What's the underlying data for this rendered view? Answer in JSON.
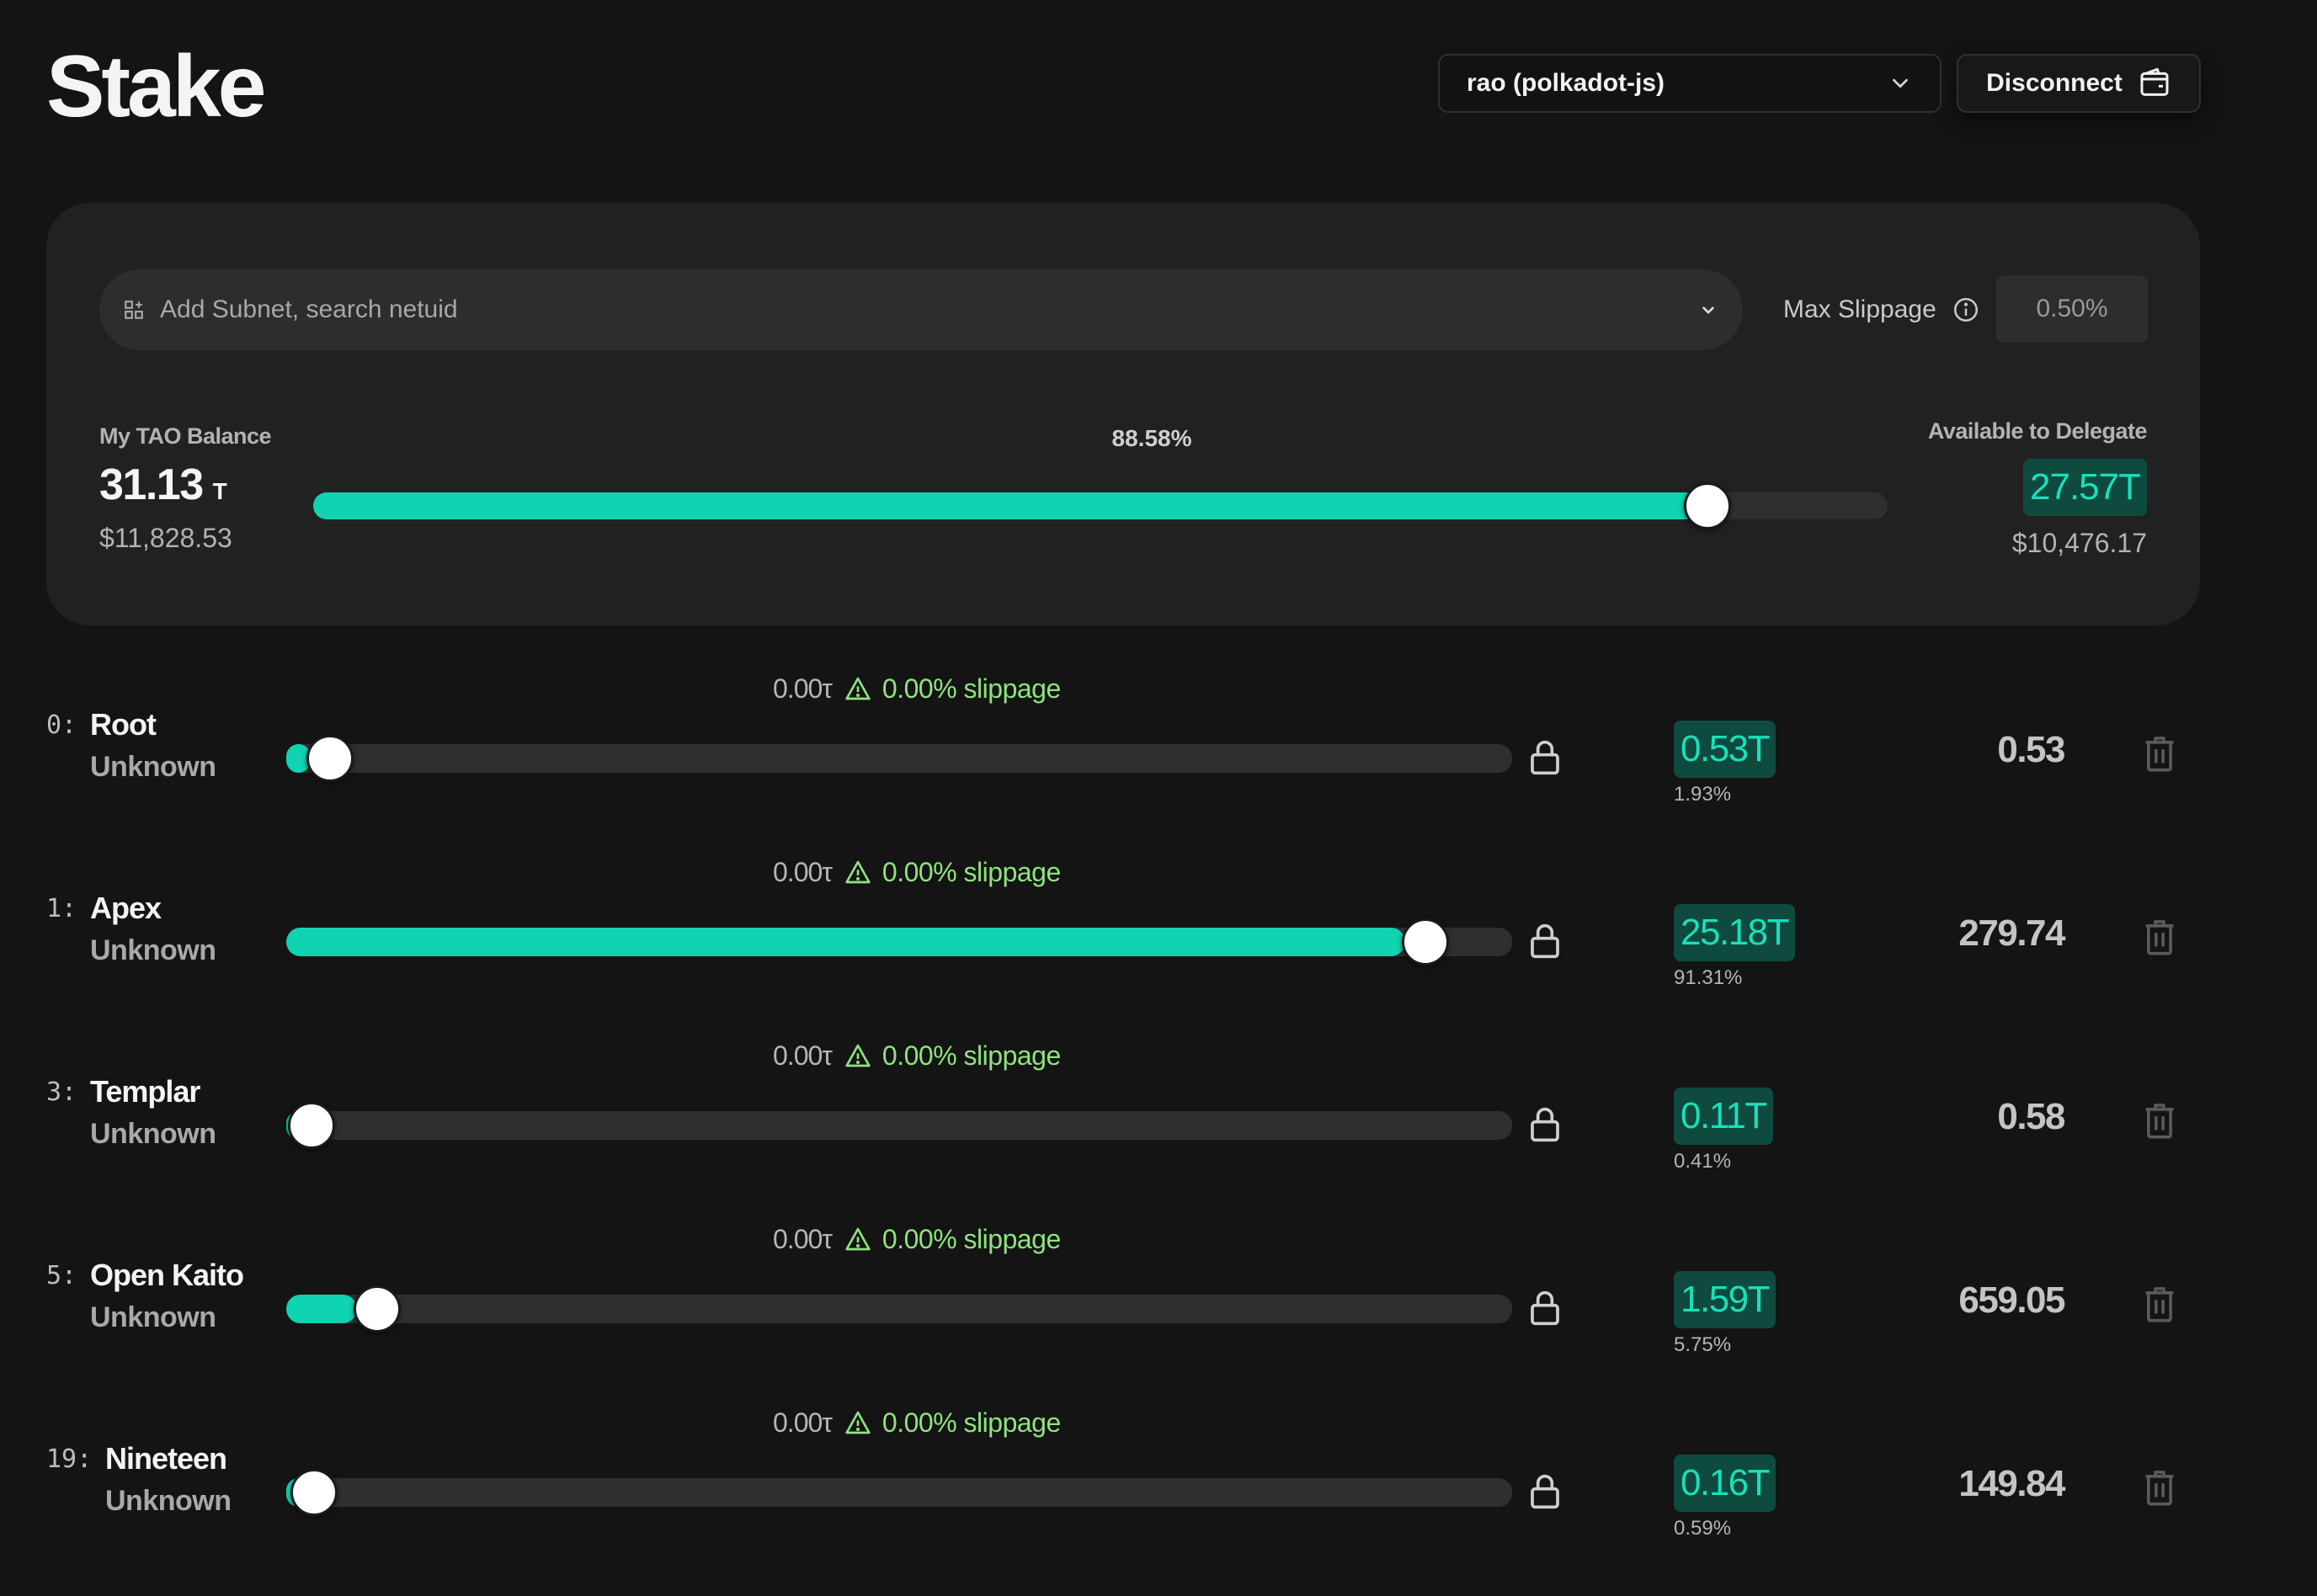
{
  "header": {
    "title": "Stake",
    "account": "rao (polkadot-js)",
    "disconnect_label": "Disconnect"
  },
  "search": {
    "placeholder": "Add Subnet, search netuid"
  },
  "slippage": {
    "label": "Max Slippage",
    "value": "0.50%"
  },
  "balance": {
    "label": "My TAO Balance",
    "value": "31.13",
    "unit": "T",
    "usd": "$11,828.53",
    "percent_label": "88.58%",
    "percent": 88.58
  },
  "delegate": {
    "label": "Available to Delegate",
    "value": "27.57T",
    "usd": "$10,476.17"
  },
  "rows": [
    {
      "id": "0:",
      "name": "Root",
      "status": "Unknown",
      "amount": "0.00τ",
      "slippage": "0.00% slippage",
      "alloc": "0.53T",
      "alloc_pct": "1.93%",
      "fill": 1.93,
      "value": "0.53"
    },
    {
      "id": "1:",
      "name": "Apex",
      "status": "Unknown",
      "amount": "0.00τ",
      "slippage": "0.00% slippage",
      "alloc": "25.18T",
      "alloc_pct": "91.31%",
      "fill": 91.31,
      "value": "279.74"
    },
    {
      "id": "3:",
      "name": "Templar",
      "status": "Unknown",
      "amount": "0.00τ",
      "slippage": "0.00% slippage",
      "alloc": "0.11T",
      "alloc_pct": "0.41%",
      "fill": 0.41,
      "value": "0.58"
    },
    {
      "id": "5:",
      "name": "Open Kaito",
      "status": "Unknown",
      "amount": "0.00τ",
      "slippage": "0.00% slippage",
      "alloc": "1.59T",
      "alloc_pct": "5.75%",
      "fill": 5.75,
      "value": "659.05"
    },
    {
      "id": "19:",
      "name": "Nineteen",
      "status": "Unknown",
      "amount": "0.00τ",
      "slippage": "0.00% slippage",
      "alloc": "0.16T",
      "alloc_pct": "0.59%",
      "fill": 0.59,
      "value": "149.84"
    }
  ],
  "colors": {
    "accent": "#0fd3b1",
    "badge_bg": "#0f4a3f",
    "warning": "#8fe37f",
    "background": "#141414",
    "card": "#212121"
  },
  "icons": {
    "account_dropdown": "chevron-down-icon",
    "disconnect": "wallet-icon",
    "search": "add-grid-icon",
    "slippage_info": "info-icon",
    "row_warning": "warning-icon",
    "row_lock": "lock-icon",
    "row_delete": "trash-icon"
  }
}
